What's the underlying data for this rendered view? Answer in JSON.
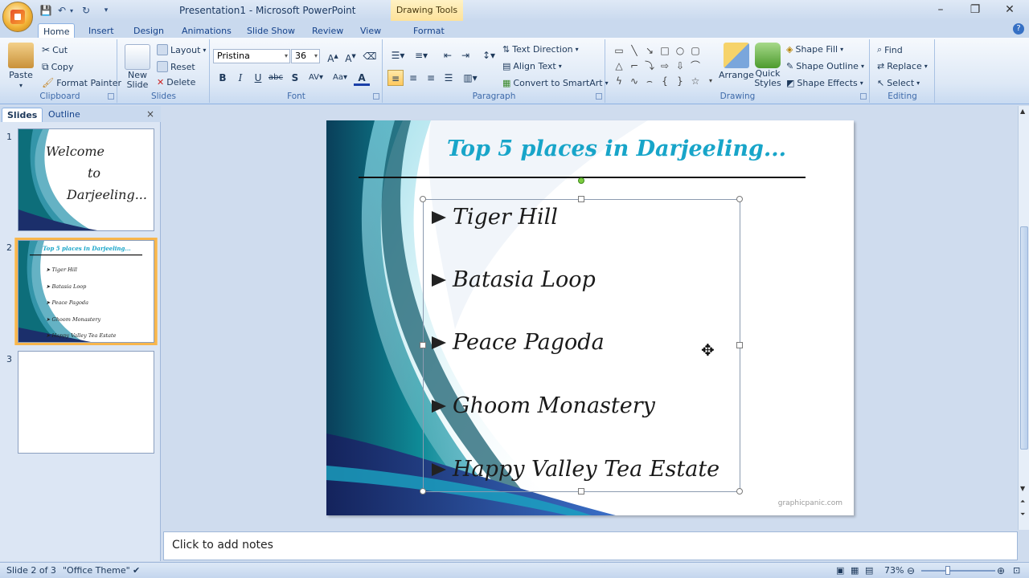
{
  "window": {
    "title": "Presentation1 - Microsoft PowerPoint",
    "contextual_tab": "Drawing Tools"
  },
  "tabs": [
    "Home",
    "Insert",
    "Design",
    "Animations",
    "Slide Show",
    "Review",
    "View",
    "Format"
  ],
  "active_tab": "Home",
  "ribbon": {
    "clipboard": {
      "label": "Clipboard",
      "paste": "Paste",
      "cut": "Cut",
      "copy": "Copy",
      "format_painter": "Format Painter"
    },
    "slides": {
      "label": "Slides",
      "new_slide": "New Slide",
      "layout": "Layout",
      "reset": "Reset",
      "delete": "Delete"
    },
    "font": {
      "label": "Font",
      "font_name": "Pristina",
      "font_size": "36"
    },
    "paragraph": {
      "label": "Paragraph",
      "text_direction": "Text Direction",
      "align_text": "Align Text",
      "convert_smartart": "Convert to SmartArt"
    },
    "drawing": {
      "label": "Drawing",
      "arrange": "Arrange",
      "quick_styles": "Quick Styles",
      "shape_fill": "Shape Fill",
      "shape_outline": "Shape Outline",
      "shape_effects": "Shape Effects"
    },
    "editing": {
      "label": "Editing",
      "find": "Find",
      "replace": "Replace",
      "select": "Select"
    }
  },
  "pane": {
    "tabs": [
      "Slides",
      "Outline"
    ],
    "thumb1_lines": [
      "Welcome",
      "to",
      "Darjeeling..."
    ],
    "slide_numbers": [
      "1",
      "2",
      "3"
    ]
  },
  "slide": {
    "title": "Top 5 places in Darjeeling...",
    "bullets": [
      "Tiger Hill",
      "Batasia Loop",
      "Peace Pagoda",
      "Ghoom Monastery",
      "Happy Valley Tea Estate"
    ],
    "watermark": "graphicpanic.com"
  },
  "notes": {
    "placeholder": "Click to add notes"
  },
  "status": {
    "slide_info": "Slide 2 of 3",
    "theme": "\"Office Theme\"",
    "zoom": "73%"
  },
  "colors": {
    "title_accent": "#18a5c9",
    "selection_orange": "#f8b64c"
  }
}
